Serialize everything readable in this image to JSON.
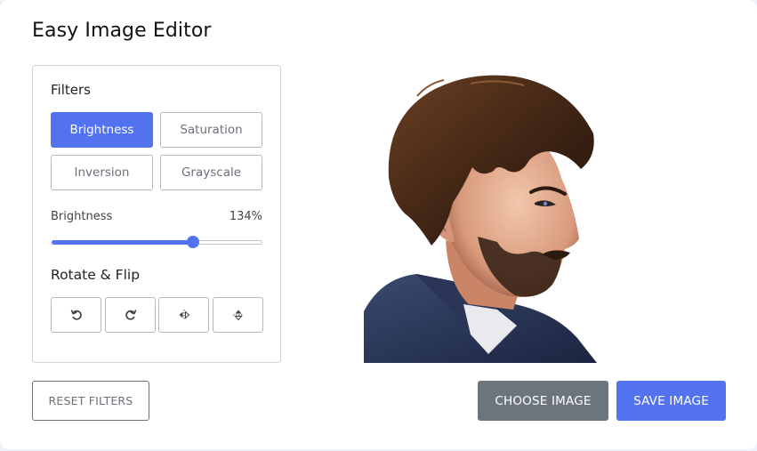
{
  "app": {
    "title": "Easy Image Editor"
  },
  "filters": {
    "heading": "Filters",
    "buttons": [
      {
        "label": "Brightness",
        "active": true
      },
      {
        "label": "Saturation",
        "active": false
      },
      {
        "label": "Inversion",
        "active": false
      },
      {
        "label": "Grayscale",
        "active": false
      }
    ],
    "slider": {
      "name": "Brightness",
      "value_text": "134%",
      "value": 134,
      "max": 200
    }
  },
  "rotate_flip": {
    "heading": "Rotate & Flip",
    "icons": [
      "rotate-left-icon",
      "rotate-right-icon",
      "flip-horizontal-icon",
      "flip-vertical-icon"
    ]
  },
  "actions": {
    "reset_label": "RESET FILTERS",
    "choose_label": "CHOOSE IMAGE",
    "save_label": "SAVE IMAGE"
  },
  "colors": {
    "accent": "#5372f0",
    "secondary": "#6c757d"
  }
}
